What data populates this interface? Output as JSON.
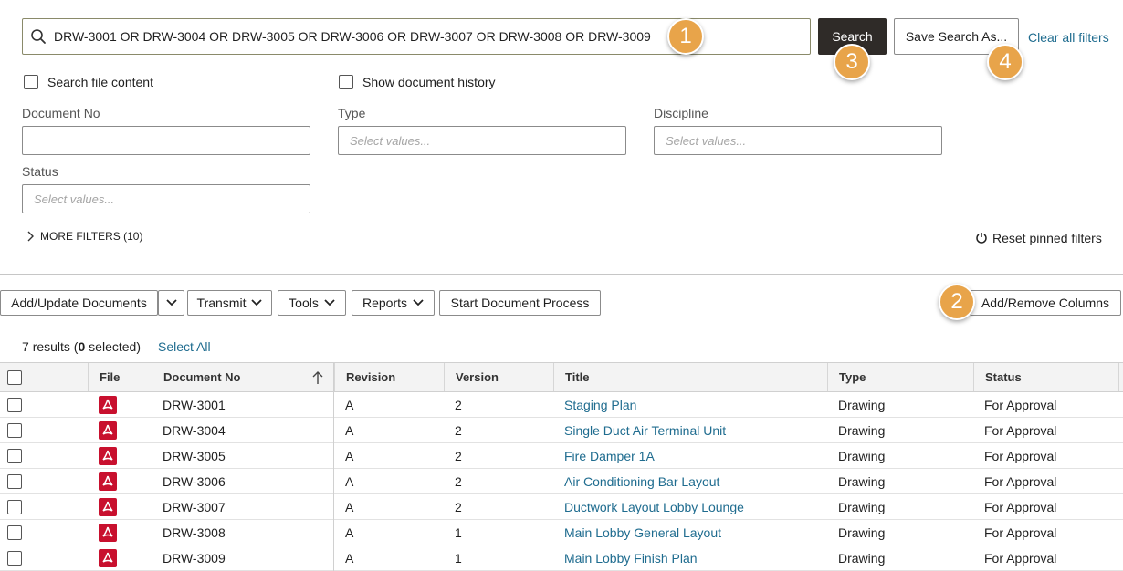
{
  "search": {
    "query": "DRW-3001 OR DRW-3004 OR DRW-3005 OR DRW-3006 OR DRW-3007 OR DRW-3008 OR DRW-3009",
    "search_button": "Search",
    "save_button": "Save Search As...",
    "clear_link": "Clear all filters"
  },
  "badges": [
    "1",
    "2",
    "3",
    "4"
  ],
  "options": {
    "search_file_content": "Search file content",
    "show_document_history": "Show document history"
  },
  "filters": {
    "document_no": {
      "label": "Document No",
      "value": ""
    },
    "type": {
      "label": "Type",
      "placeholder": "Select values..."
    },
    "discipline": {
      "label": "Discipline",
      "placeholder": "Select values..."
    },
    "status": {
      "label": "Status",
      "placeholder": "Select values..."
    },
    "more_filters": "MORE FILTERS (10)",
    "reset_pinned": "Reset pinned filters"
  },
  "toolbar": {
    "add_update": "Add/Update Documents",
    "transmit": "Transmit",
    "tools": "Tools",
    "reports": "Reports",
    "start_process": "Start Document Process",
    "add_remove_columns": "Add/Remove Columns"
  },
  "results": {
    "count": "7",
    "results_word": "results (",
    "selected": "0",
    "selected_word": " selected)",
    "select_all": "Select All"
  },
  "table": {
    "columns": [
      "File",
      "Document No",
      "Revision",
      "Version",
      "Title",
      "Type",
      "Status"
    ],
    "rows": [
      {
        "doc_no": "DRW-3001",
        "revision": "A",
        "version": "2",
        "title": "Staging Plan",
        "type": "Drawing",
        "status": "For Approval"
      },
      {
        "doc_no": "DRW-3004",
        "revision": "A",
        "version": "2",
        "title": "Single Duct Air Terminal Unit",
        "type": "Drawing",
        "status": "For Approval"
      },
      {
        "doc_no": "DRW-3005",
        "revision": "A",
        "version": "2",
        "title": "Fire Damper 1A",
        "type": "Drawing",
        "status": "For Approval"
      },
      {
        "doc_no": "DRW-3006",
        "revision": "A",
        "version": "2",
        "title": "Air Conditioning Bar Layout",
        "type": "Drawing",
        "status": "For Approval"
      },
      {
        "doc_no": "DRW-3007",
        "revision": "A",
        "version": "2",
        "title": "Ductwork Layout Lobby Lounge",
        "type": "Drawing",
        "status": "For Approval"
      },
      {
        "doc_no": "DRW-3008",
        "revision": "A",
        "version": "1",
        "title": "Main Lobby General Layout",
        "type": "Drawing",
        "status": "For Approval"
      },
      {
        "doc_no": "DRW-3009",
        "revision": "A",
        "version": "1",
        "title": "Main Lobby Finish Plan",
        "type": "Drawing",
        "status": "For Approval"
      }
    ]
  },
  "colors": {
    "accent_link": "#1f6c8f",
    "badge": "#e8a44a",
    "search_button_bg": "#2f2b28",
    "pdf_icon": "#c8102e"
  },
  "icons": {
    "search": "search-icon",
    "pdf": "pdf-icon",
    "reset": "reset-icon",
    "sort": "sort-ascending-icon",
    "chevron": "chevron-down-icon"
  }
}
